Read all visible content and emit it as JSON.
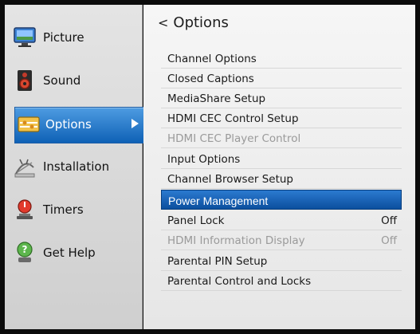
{
  "sidebar": {
    "items": [
      {
        "label": "Picture",
        "icon": "monitor-icon"
      },
      {
        "label": "Sound",
        "icon": "speaker-icon"
      },
      {
        "label": "Options",
        "icon": "options-icon",
        "selected": true
      },
      {
        "label": "Installation",
        "icon": "satellite-dish-icon"
      },
      {
        "label": "Timers",
        "icon": "timer-icon"
      },
      {
        "label": "Get Help",
        "icon": "help-icon"
      }
    ]
  },
  "main": {
    "back_glyph": "<",
    "title": "Options",
    "items": [
      {
        "label": "Channel Options",
        "value": ""
      },
      {
        "label": "Closed Captions",
        "value": ""
      },
      {
        "label": "MediaShare Setup",
        "value": ""
      },
      {
        "label": "HDMI CEC Control Setup",
        "value": ""
      },
      {
        "label": "HDMI CEC Player Control",
        "value": "",
        "disabled": true
      },
      {
        "label": "Input Options",
        "value": ""
      },
      {
        "label": "Channel Browser Setup",
        "value": ""
      },
      {
        "label": "Power Management",
        "value": "",
        "highlighted": true
      },
      {
        "label": "Panel Lock",
        "value": "Off"
      },
      {
        "label": "HDMI Information Display",
        "value": "Off",
        "disabled": true
      },
      {
        "label": "Parental PIN Setup",
        "value": ""
      },
      {
        "label": "Parental Control and Locks",
        "value": ""
      }
    ]
  },
  "colors": {
    "selection": "#1b6fc8",
    "background": "#0b0b0b"
  }
}
